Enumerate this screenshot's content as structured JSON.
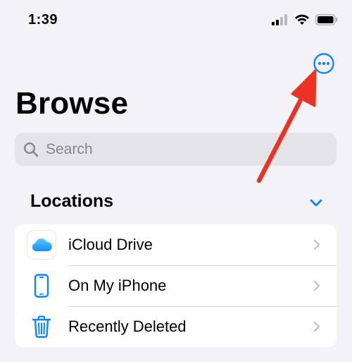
{
  "status_bar": {
    "time": "1:39"
  },
  "header": {
    "title": "Browse",
    "more_button_icon": "ellipsis-circle-icon"
  },
  "search": {
    "placeholder": "Search",
    "value": ""
  },
  "locations": {
    "header": "Locations",
    "items": [
      {
        "label": "iCloud Drive",
        "icon": "icloud-icon"
      },
      {
        "label": "On My iPhone",
        "icon": "iphone-icon"
      },
      {
        "label": "Recently Deleted",
        "icon": "trash-icon"
      }
    ]
  },
  "colors": {
    "accent": "#0a84ff",
    "background": "#f2f2f7",
    "search_bg": "#e3e3e8",
    "annotation_arrow": "#ea3323"
  }
}
